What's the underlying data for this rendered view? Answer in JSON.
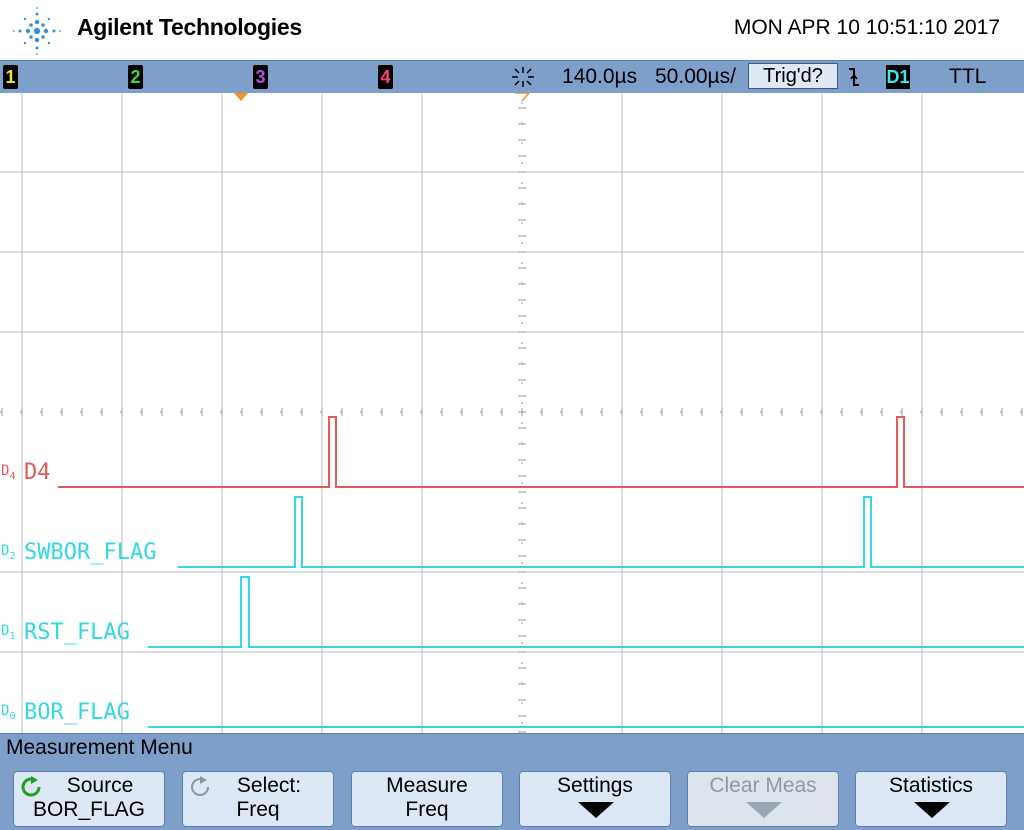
{
  "header": {
    "brand": "Agilent Technologies",
    "datetime": "MON APR 10 10:51:10 2017"
  },
  "statusbar": {
    "channels": [
      {
        "label": "1",
        "color": "#f0e23a"
      },
      {
        "label": "2",
        "color": "#44d63c"
      },
      {
        "label": "3",
        "color": "#b04ae0"
      },
      {
        "label": "4",
        "color": "#ff3f7a"
      }
    ],
    "time_offset": "140.0µs",
    "time_per_div": "50.00µs/",
    "trigger_status": "Trig'd?",
    "trigger_slope_icon": "falling-edge-icon",
    "trigger_source": "D1",
    "trigger_level": "TTL"
  },
  "traces": [
    {
      "name": "D4",
      "label": "D4",
      "marker_main": "D",
      "marker_sub": "4",
      "color": "#e05a5a"
    },
    {
      "name": "SWBOR_FLAG",
      "label": "SWBOR_FLAG",
      "marker_main": "D",
      "marker_sub": "2",
      "color": "#33d8e4"
    },
    {
      "name": "RST_FLAG",
      "label": "RST_FLAG",
      "marker_main": "D",
      "marker_sub": "1",
      "color": "#33d8e4"
    },
    {
      "name": "BOR_FLAG",
      "label": "BOR_FLAG",
      "marker_main": "D",
      "marker_sub": "0",
      "color": "#33d8e4"
    }
  ],
  "menu": {
    "title": "Measurement Menu",
    "buttons": [
      {
        "line1": "Source",
        "line2": "BOR_FLAG",
        "icon": "rotate-green-icon"
      },
      {
        "line1": "Select:",
        "line2": "Freq",
        "icon": "rotate-gray-icon"
      },
      {
        "line1": "Measure",
        "line2": "Freq"
      },
      {
        "line1": "Settings",
        "icon": "arrow-down-icon"
      },
      {
        "line1": "Clear Meas",
        "icon": "arrow-down-icon",
        "disabled": true
      },
      {
        "line1": "Statistics",
        "icon": "arrow-down-icon"
      }
    ]
  }
}
